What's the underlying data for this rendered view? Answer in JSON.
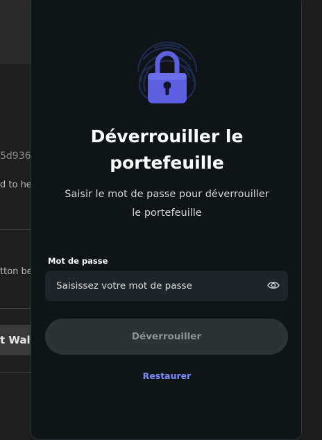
{
  "background": {
    "address_fragment": "5d936",
    "hint_fragment": "d to he",
    "button_hint_fragment": "tton be",
    "button_fragment": "t Wall"
  },
  "modal": {
    "icon": "fingerprint-lock-icon",
    "title_line1": "Déverrouiller le",
    "title_line2": "portefeuille",
    "subtitle_line1": "Saisir le mot de passe pour déverrouiller",
    "subtitle_line2": "le portefeuille",
    "password_label": "Mot de passe",
    "password_placeholder": "Saisissez votre mot de passe",
    "password_value": "",
    "eye_icon": "eye-icon",
    "unlock_label": "Déverrouiller",
    "restore_label": "Restaurer"
  },
  "colors": {
    "accent": "#7b89ff",
    "lock": "#5b5fe0",
    "modal_bg": "#0f1417",
    "button_disabled": "#2b3335"
  }
}
